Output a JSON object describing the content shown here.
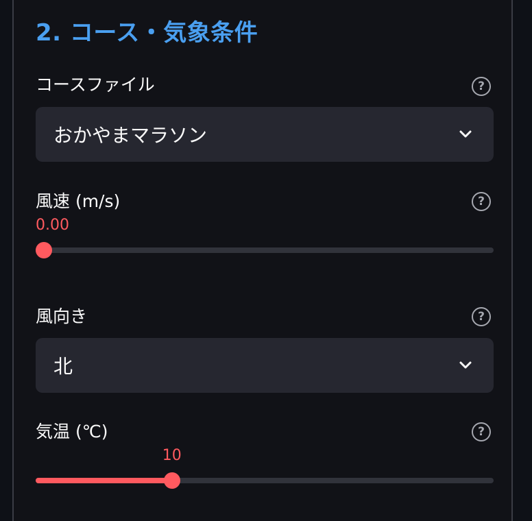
{
  "section": {
    "heading": "2. コース・気象条件"
  },
  "course": {
    "label": "コースファイル",
    "selected": "おかやまマラソン",
    "help_icon": "question-circle-icon",
    "chevron_icon": "chevron-down-icon"
  },
  "wind_speed": {
    "label": "風速 (m/s)",
    "value_text": "0.00",
    "value": 0,
    "fraction": 0.0,
    "help_icon": "question-circle-icon"
  },
  "wind_direction": {
    "label": "風向き",
    "selected": "北",
    "help_icon": "question-circle-icon",
    "chevron_icon": "chevron-down-icon"
  },
  "temperature": {
    "label": "気温 (℃)",
    "value_text": "10",
    "value": 10,
    "fraction": 0.29,
    "help_icon": "question-circle-icon"
  },
  "help_glyph": "?",
  "colors": {
    "accent": "#ff5a5f",
    "heading": "#4a9ff0",
    "background": "#0e1117",
    "input_bg": "#262730"
  }
}
